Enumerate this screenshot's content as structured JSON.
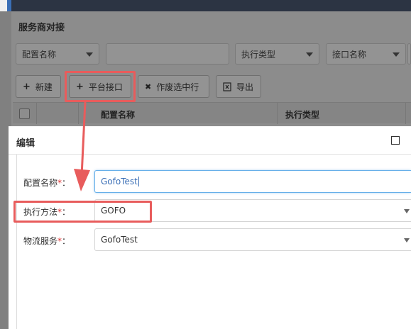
{
  "panel": {
    "title": "服务商对接",
    "filters": [
      {
        "label": "配置名称",
        "has_dropdown": true
      },
      {
        "label": "",
        "has_dropdown": false
      },
      {
        "label": "执行类型",
        "has_dropdown": true
      },
      {
        "label": "接口名称",
        "has_dropdown": true
      }
    ]
  },
  "toolbar": {
    "new_label": "新建",
    "new_icon": "+",
    "platform_api_label": "平台接口",
    "platform_api_icon": "+",
    "void_label": "作废选中行",
    "void_icon": "✖",
    "export_label": "导出"
  },
  "grid": {
    "columns": [
      "配置名称",
      "执行类型"
    ]
  },
  "modal": {
    "title": "编辑",
    "fields": [
      {
        "label": "配置名称",
        "required_mark": "*",
        "colon": "：",
        "value": "GofoTest",
        "focused": true
      },
      {
        "label": "执行方法",
        "required_mark": "*",
        "colon": "：",
        "value": "GOFO",
        "focused": false
      },
      {
        "label": "物流服务",
        "required_mark": "*",
        "colon": "：",
        "value": "GofoTest",
        "focused": false
      }
    ]
  },
  "annotation": {
    "highlight_color": "#e85c5c"
  }
}
